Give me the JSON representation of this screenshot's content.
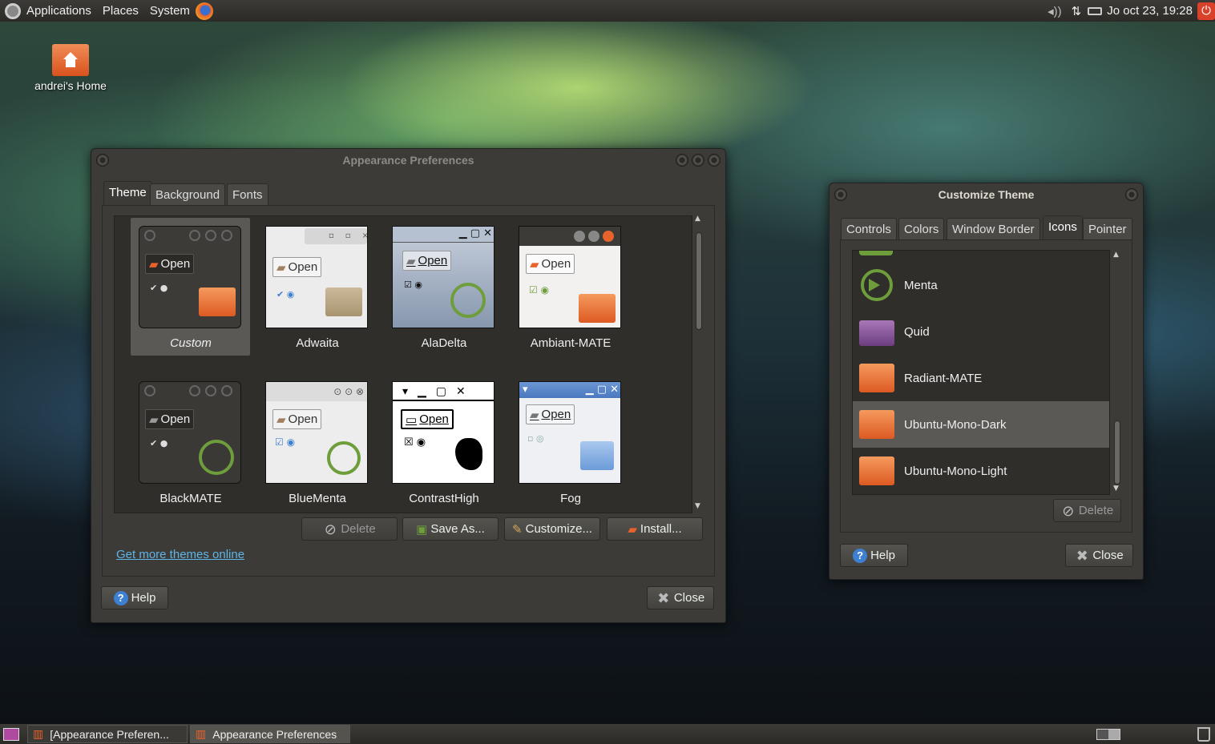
{
  "topbar": {
    "applications": "Applications",
    "places": "Places",
    "system": "System",
    "clock": "Jo oct 23, 19:28"
  },
  "desktop": {
    "home_label": "andrei's Home"
  },
  "appearance": {
    "title": "Appearance Preferences",
    "tabs": [
      "Theme",
      "Background",
      "Fonts"
    ],
    "themes": [
      "Custom",
      "Adwaita",
      "AlaDelta",
      "Ambiant-MATE",
      "BlackMATE",
      "BlueMenta",
      "ContrastHigh",
      "Fog"
    ],
    "open_label": "Open",
    "buttons": {
      "delete": "Delete",
      "save_as": "Save As...",
      "customize": "Customize...",
      "install": "Install..."
    },
    "link": "Get more themes online",
    "help": "Help",
    "close": "Close"
  },
  "customize": {
    "title": "Customize Theme",
    "tabs": [
      "Controls",
      "Colors",
      "Window Border",
      "Icons",
      "Pointer"
    ],
    "icons": [
      "Menta",
      "Quid",
      "Radiant-MATE",
      "Ubuntu-Mono-Dark",
      "Ubuntu-Mono-Light"
    ],
    "selected_icon": "Ubuntu-Mono-Dark",
    "delete": "Delete",
    "help": "Help",
    "close": "Close"
  },
  "taskbar": {
    "items": [
      "[Appearance Preferen...",
      "Appearance Preferences"
    ]
  },
  "colors": {
    "accent_orange": "#e8622c",
    "menta_green": "#6e9e3c",
    "selection": "#5a5955"
  }
}
